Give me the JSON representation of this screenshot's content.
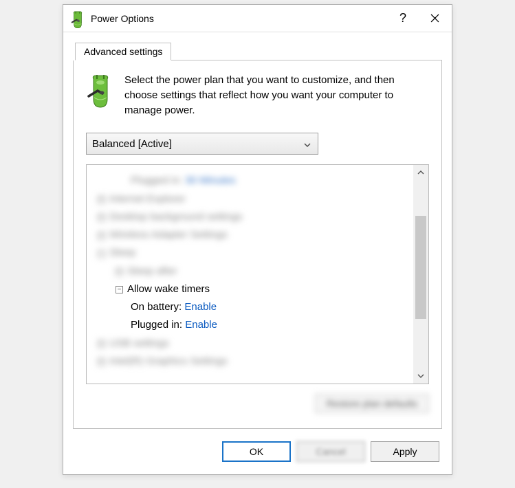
{
  "window": {
    "title": "Power Options"
  },
  "tab": {
    "label": "Advanced settings"
  },
  "intro": "Select the power plan that you want to customize, and then choose settings that reflect how you want your computer to manage power.",
  "dropdown": {
    "value": "Balanced [Active]"
  },
  "tree": {
    "blur_top1": {
      "label": "Plugged in:",
      "value": "30 Minutes"
    },
    "blur_cat1": "Internet Explorer",
    "blur_cat2": "Desktop background settings",
    "blur_cat3": "Wireless Adapter Settings",
    "blur_cat4": "Sleep",
    "blur_sub1": "Sleep after",
    "wake": {
      "label": "Allow wake timers",
      "battery_label": "On battery:",
      "battery_value": "Enable",
      "plugged_label": "Plugged in:",
      "plugged_value": "Enable"
    },
    "blur_cat5": "USB settings",
    "blur_cat6": "Intel(R) Graphics Settings"
  },
  "restore": {
    "label": "Restore plan defaults"
  },
  "buttons": {
    "ok": "OK",
    "cancel": "Cancel",
    "apply": "Apply"
  }
}
